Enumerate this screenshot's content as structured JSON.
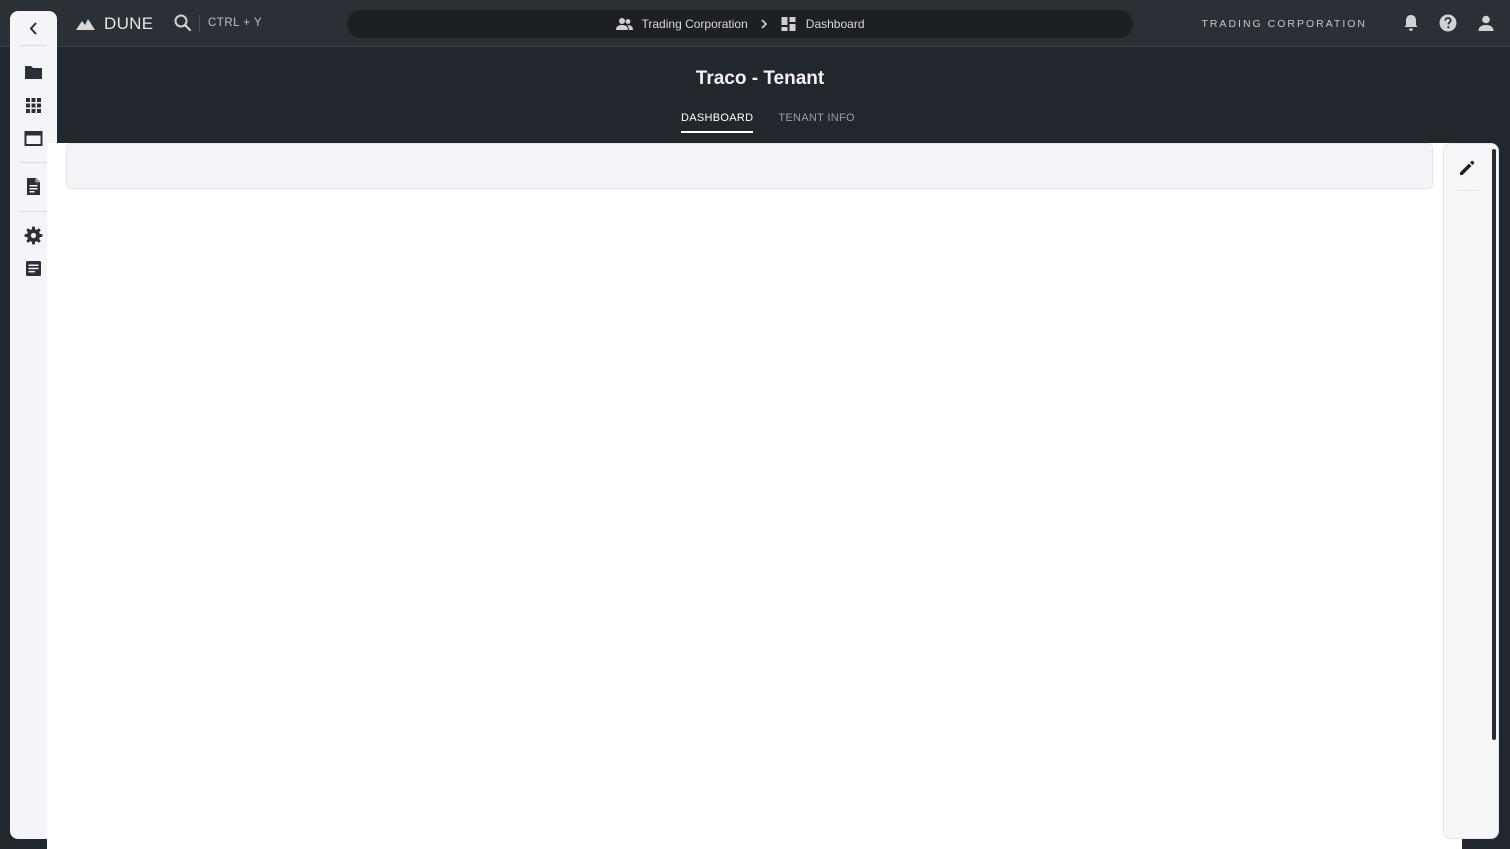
{
  "app": {
    "name": "DUNE",
    "search_shortcut": "CTRL + Y"
  },
  "breadcrumb": {
    "items": [
      {
        "label": "Trading Corporation",
        "icon": "people-icon"
      },
      {
        "label": "Dashboard",
        "icon": "dashboard-icon"
      }
    ]
  },
  "header": {
    "tenant_name": "TRADING CORPORATION"
  },
  "sidebar": {
    "items": [
      {
        "icon": "chevron-left-icon",
        "label": "Collapse"
      },
      {
        "icon": "folder-icon",
        "label": "Folders"
      },
      {
        "icon": "apps-grid-icon",
        "label": "Apps"
      },
      {
        "icon": "window-icon",
        "label": "Windows"
      },
      {
        "icon": "document-icon",
        "label": "Documents"
      },
      {
        "icon": "gear-icon",
        "label": "Settings"
      },
      {
        "icon": "notes-icon",
        "label": "Logs"
      }
    ]
  },
  "page": {
    "title": "Traco - Tenant",
    "tabs": [
      {
        "label": "DASHBOARD",
        "active": true
      },
      {
        "label": "TENANT INFO",
        "active": false
      }
    ]
  },
  "colors": {
    "background": "#22262d",
    "topbar": "#2b2f36",
    "breadcrumb_pill": "#1c1f24",
    "sidebar": "#f4f5f8",
    "content": "#ffffff"
  }
}
